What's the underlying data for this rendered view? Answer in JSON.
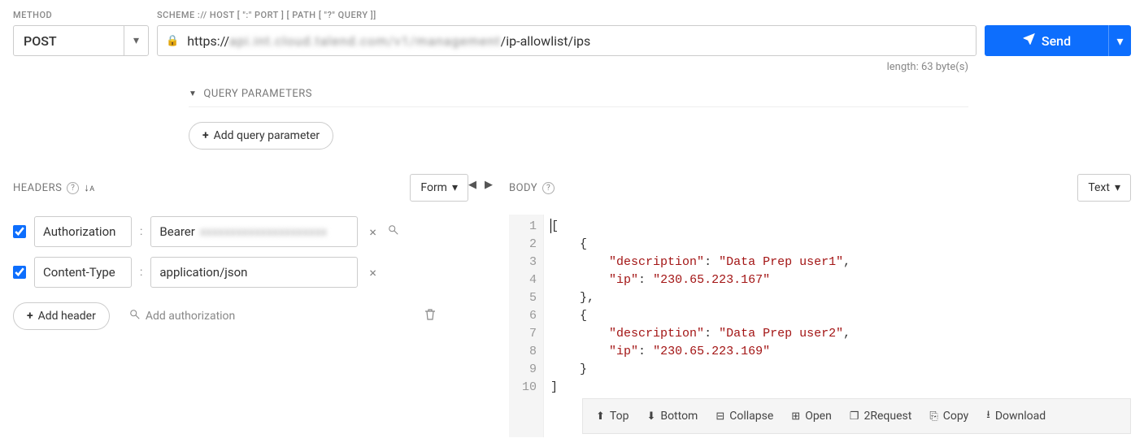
{
  "labels": {
    "method": "METHOD",
    "scheme": "SCHEME :// HOST [ \":\" PORT ] [ PATH [ \"?\" QUERY ]]",
    "headers": "HEADERS",
    "body": "BODY",
    "query_params": "QUERY PARAMETERS"
  },
  "method": {
    "value": "POST"
  },
  "url": {
    "prefix": "https://",
    "masked": "api.int.cloud.talend.com/v1/management",
    "suffix": "/ip-allowlist/ips"
  },
  "send": {
    "label": "Send"
  },
  "length_text": "length: 63 byte(s)",
  "buttons": {
    "add_query": "Add query parameter",
    "add_header": "Add header",
    "add_auth": "Add authorization",
    "form": "Form",
    "text": "Text"
  },
  "headers": [
    {
      "enabled": true,
      "name": "Authorization",
      "value_prefix": "Bearer",
      "value_masked": "xxxxxxxxxxxxxxxxxxxxx",
      "has_mag": true
    },
    {
      "enabled": true,
      "name": "Content-Type",
      "value_prefix": "application/json",
      "value_masked": "",
      "has_mag": false
    }
  ],
  "body_lines": [
    {
      "n": 1,
      "indent": 0,
      "tokens": [
        {
          "t": "punc",
          "v": "["
        }
      ],
      "cursor": true
    },
    {
      "n": 2,
      "indent": 1,
      "tokens": [
        {
          "t": "punc",
          "v": "{"
        }
      ]
    },
    {
      "n": 3,
      "indent": 2,
      "tokens": [
        {
          "t": "key",
          "v": "\"description\""
        },
        {
          "t": "punc",
          "v": ": "
        },
        {
          "t": "str",
          "v": "\"Data Prep user1\""
        },
        {
          "t": "punc",
          "v": ","
        }
      ]
    },
    {
      "n": 4,
      "indent": 2,
      "tokens": [
        {
          "t": "key",
          "v": "\"ip\""
        },
        {
          "t": "punc",
          "v": ": "
        },
        {
          "t": "str",
          "v": "\"230.65.223.167\""
        }
      ]
    },
    {
      "n": 5,
      "indent": 1,
      "tokens": [
        {
          "t": "punc",
          "v": "},"
        }
      ]
    },
    {
      "n": 6,
      "indent": 1,
      "tokens": [
        {
          "t": "punc",
          "v": "{"
        }
      ]
    },
    {
      "n": 7,
      "indent": 2,
      "tokens": [
        {
          "t": "key",
          "v": "\"description\""
        },
        {
          "t": "punc",
          "v": ": "
        },
        {
          "t": "str",
          "v": "\"Data Prep user2\""
        },
        {
          "t": "punc",
          "v": ","
        }
      ]
    },
    {
      "n": 8,
      "indent": 2,
      "tokens": [
        {
          "t": "key",
          "v": "\"ip\""
        },
        {
          "t": "punc",
          "v": ": "
        },
        {
          "t": "str",
          "v": "\"230.65.223.169\""
        }
      ]
    },
    {
      "n": 9,
      "indent": 1,
      "tokens": [
        {
          "t": "punc",
          "v": "}"
        }
      ]
    },
    {
      "n": 10,
      "indent": 0,
      "tokens": [
        {
          "t": "punc",
          "v": "]"
        }
      ]
    }
  ],
  "toolbar": {
    "top": "Top",
    "bottom": "Bottom",
    "collapse": "Collapse",
    "open": "Open",
    "request": "2Request",
    "copy": "Copy",
    "download": "Download"
  }
}
